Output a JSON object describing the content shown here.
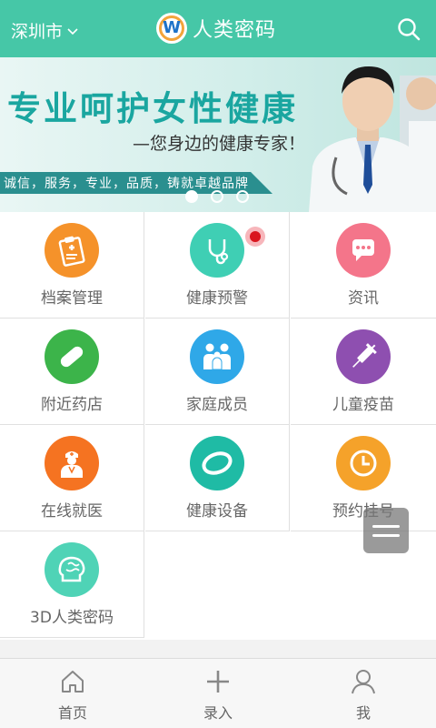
{
  "header": {
    "city": "深圳市",
    "app_title": "人类密码",
    "logo_letter": "W"
  },
  "banner": {
    "headline": "专业呵护女性健康",
    "subtitle": "—您身边的健康专家！",
    "slogan": "诚信，服务，专业，品质，铸就卓越品牌",
    "slides_count": 3,
    "active_slide": 1
  },
  "grid": {
    "items": [
      {
        "label": "档案管理",
        "color": "#f5922a",
        "icon": "clipboard-icon"
      },
      {
        "label": "健康预警",
        "color": "#3fcfb4",
        "icon": "stethoscope-icon",
        "badge": true
      },
      {
        "label": "资讯",
        "color": "#f4758a",
        "icon": "chat-bubble-icon"
      },
      {
        "label": "附近药店",
        "color": "#3cb44a",
        "icon": "pill-icon"
      },
      {
        "label": "家庭成员",
        "color": "#2fa8e8",
        "icon": "family-icon"
      },
      {
        "label": "儿童疫苗",
        "color": "#8e4fb0",
        "icon": "syringe-icon"
      },
      {
        "label": "在线就医",
        "color": "#f57321",
        "icon": "doctor-icon"
      },
      {
        "label": "健康设备",
        "color": "#1fbba5",
        "icon": "wristband-icon"
      },
      {
        "label": "预约挂号",
        "color": "#f5a22a",
        "icon": "clock-icon"
      },
      {
        "label": "3D人类密码",
        "color": "#4fd3b6",
        "icon": "brain-icon"
      }
    ]
  },
  "bottom_nav": {
    "items": [
      {
        "label": "首页",
        "icon": "home-icon"
      },
      {
        "label": "录入",
        "icon": "plus-icon"
      },
      {
        "label": "我",
        "icon": "user-icon"
      }
    ]
  },
  "colors": {
    "header_bg": "#46c7a7",
    "badge_dot": "#d9151e"
  }
}
